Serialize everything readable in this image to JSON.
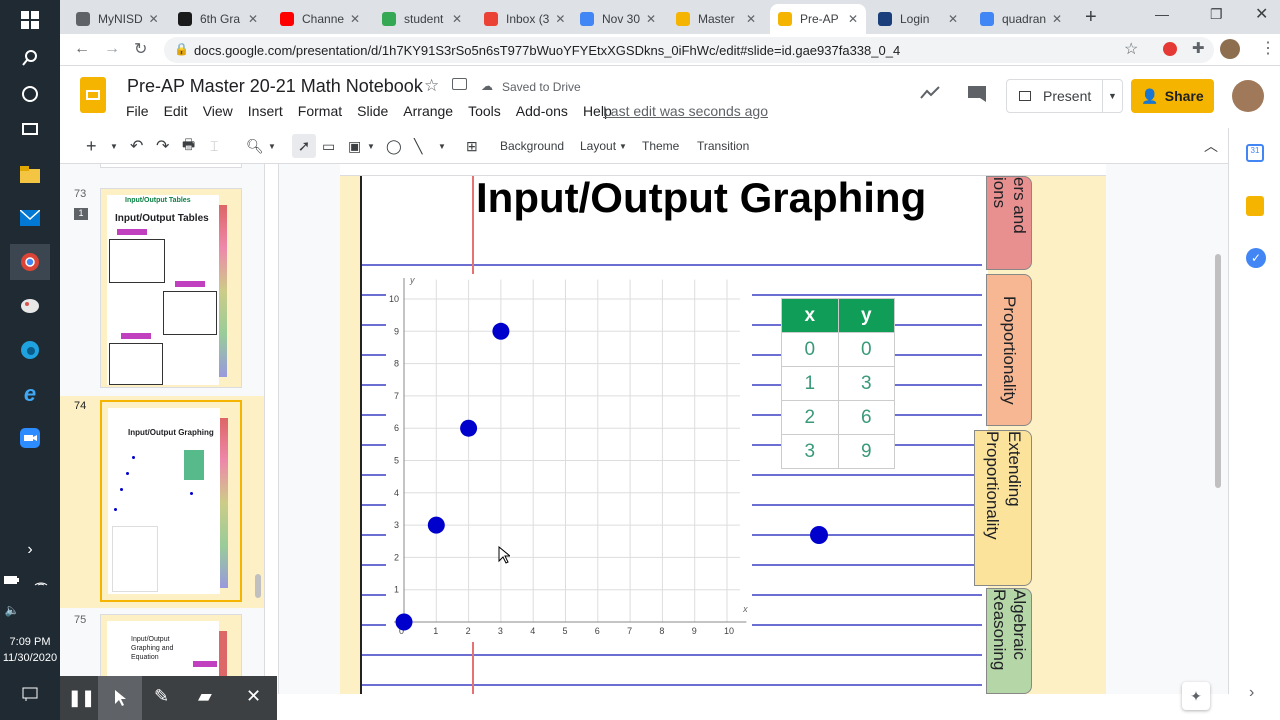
{
  "browser": {
    "tabs": [
      {
        "label": "MyNISD",
        "color": "#5f6368"
      },
      {
        "label": "6th Gra",
        "color": "#1a1a1a"
      },
      {
        "label": "Channe",
        "color": "#ff0000"
      },
      {
        "label": "student",
        "color": "#34a853"
      },
      {
        "label": "Inbox (3",
        "color": "#ea4335"
      },
      {
        "label": "Nov 30",
        "color": "#4285f4"
      },
      {
        "label": "Master",
        "color": "#f4b400"
      },
      {
        "label": "Pre-AP",
        "color": "#f4b400"
      },
      {
        "label": "Login",
        "color": "#1a3d7c"
      },
      {
        "label": "quadran",
        "color": "#4285f4"
      }
    ],
    "url": "docs.google.com/presentation/d/1h7KY91S3rSo5n6sT977bWuoYFYEtxXGSDkns_0iFhWc/edit#slide=id.gae937fa338_0_4"
  },
  "app": {
    "title": "Pre-AP Master 20-21 Math Notebook",
    "saved": "Saved to Drive",
    "menu": [
      "File",
      "Edit",
      "View",
      "Insert",
      "Format",
      "Slide",
      "Arrange",
      "Tools",
      "Add-ons",
      "Help"
    ],
    "last_edit": "Last edit was seconds ago",
    "present": "Present",
    "share": "Share"
  },
  "toolbar": {
    "background": "Background",
    "layout": "Layout",
    "theme": "Theme",
    "transition": "Transition"
  },
  "filmstrip": {
    "slides": [
      {
        "num": "73",
        "title": "Input/Output Tables",
        "subtitle": "Input/Output Tables",
        "comments": "1"
      },
      {
        "num": "74",
        "title": "Input/Output Graphing"
      },
      {
        "num": "75",
        "title": "Input/Output Graphing and Equation"
      }
    ]
  },
  "slide": {
    "title": "Input/Output Graphing",
    "side_tabs": [
      "ers and ions",
      "Proportionality",
      "Extending Proportionality",
      "Algebraic Reasoning"
    ],
    "table": {
      "headers": [
        "x",
        "y"
      ],
      "rows": [
        [
          "0",
          "0"
        ],
        [
          "1",
          "3"
        ],
        [
          "2",
          "6"
        ],
        [
          "3",
          "9"
        ]
      ]
    },
    "axis_x_label": "x",
    "axis_y_label": "y"
  },
  "chart_data": {
    "type": "scatter",
    "x": [
      0,
      1,
      2,
      3
    ],
    "y": [
      0,
      3,
      6,
      9
    ],
    "xlim": [
      0,
      10
    ],
    "ylim": [
      0,
      10
    ],
    "x_ticks": [
      "0",
      "1",
      "2",
      "3",
      "4",
      "5",
      "6",
      "7",
      "8",
      "9",
      "10"
    ],
    "y_ticks": [
      "1",
      "2",
      "3",
      "4",
      "5",
      "6",
      "7",
      "8",
      "9",
      "10"
    ],
    "grid": true,
    "point_color": "#0000cc"
  },
  "taskbar": {
    "time": "7:09 PM",
    "date": "11/30/2020"
  },
  "colors": {
    "accent": "#f4b400",
    "table_header": "#0f9d58",
    "rule_line": "#6a6fd1",
    "margin_line": "#e57373"
  }
}
